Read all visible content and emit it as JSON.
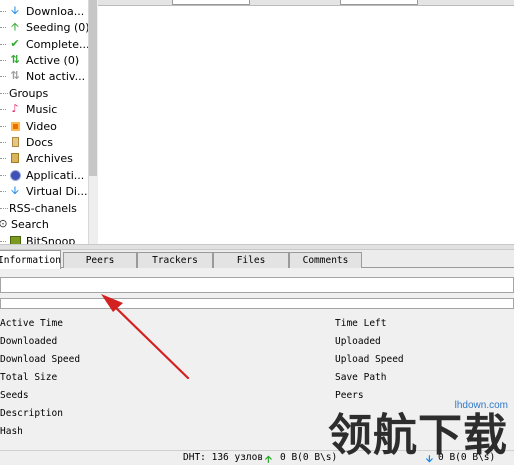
{
  "sidebar": {
    "items": [
      {
        "label": "Downloa...",
        "icon": "download-arrow-icon",
        "color": "#1e88e5"
      },
      {
        "label": "Seeding (0)",
        "icon": "upload-arrow-icon",
        "color": "#2eaa2e"
      },
      {
        "label": "Complete...",
        "icon": "checkmark-icon",
        "color": "#2eaa2e"
      },
      {
        "label": "Active (0)",
        "icon": "active-transfer-icon",
        "color": "#2eaa2e"
      },
      {
        "label": "Not activ...",
        "icon": "inactive-transfer-icon",
        "color": "#9e9e9e"
      },
      {
        "label": "Groups",
        "icon": "",
        "color": ""
      },
      {
        "label": "Music",
        "icon": "music-note-icon",
        "color": "#e91e63"
      },
      {
        "label": "Video",
        "icon": "video-icon",
        "color": "#ef6c00"
      },
      {
        "label": "Docs",
        "icon": "document-icon",
        "color": "#c8a24a"
      },
      {
        "label": "Archives",
        "icon": "archive-icon",
        "color": "#c8a24a"
      },
      {
        "label": "Applicati...",
        "icon": "application-icon",
        "color": "#3f51b5"
      },
      {
        "label": "Virtual Di...",
        "icon": "virtual-disk-icon",
        "color": "#1e88e5"
      },
      {
        "label": "RSS-chanels",
        "icon": "",
        "color": ""
      },
      {
        "label": "Search",
        "icon": "search-icon",
        "color": "#333333"
      },
      {
        "label": "BitSnoop",
        "icon": "bitsnoop-icon",
        "color": "#7a9a20"
      }
    ]
  },
  "tabs": [
    "Information",
    "Peers",
    "Trackers",
    "Files",
    "Comments"
  ],
  "info": {
    "left_labels": [
      "Active Time",
      "Downloaded",
      "Download Speed",
      "Total Size",
      "Seeds",
      "Description",
      "Hash"
    ],
    "right_labels": [
      "Time Left",
      "Uploaded",
      "Upload Speed",
      "Save Path",
      "Peers"
    ]
  },
  "status": {
    "dht": "DHT: 136 узлов",
    "upload": "0 B(0 B\\s)",
    "download": "0 B(0 B\\s)"
  },
  "watermark": {
    "site": "lhdown.com",
    "title": "领航下载"
  }
}
